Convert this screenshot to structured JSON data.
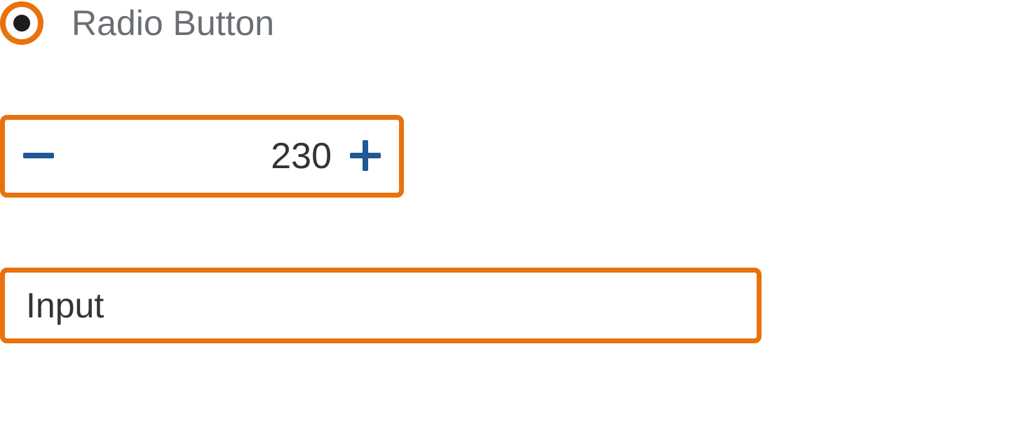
{
  "radio": {
    "label": "Radio Button",
    "selected": true
  },
  "stepper": {
    "value": "230"
  },
  "input": {
    "placeholder": "Input",
    "value": ""
  },
  "colors": {
    "accent": "#E8720C",
    "iconBlue": "#1F5894",
    "textGray": "#6b6f73",
    "textDark": "#333333"
  }
}
